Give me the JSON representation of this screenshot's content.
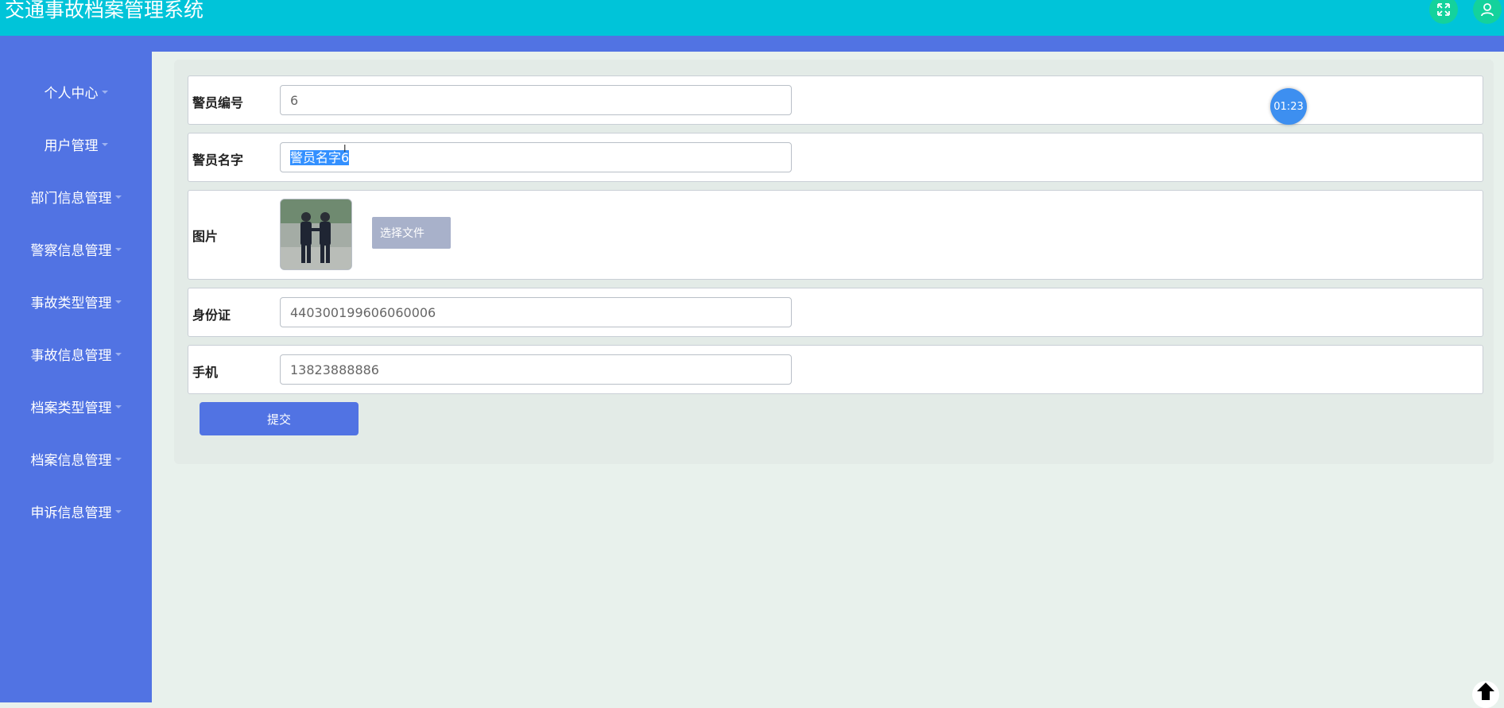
{
  "header": {
    "title": "交通事故档案管理系统",
    "fullscreen_icon": "expand-arrows-icon",
    "user_icon": "user-icon"
  },
  "sidebar": {
    "items": [
      {
        "label": "个人中心"
      },
      {
        "label": "用户管理"
      },
      {
        "label": "部门信息管理"
      },
      {
        "label": "警察信息管理"
      },
      {
        "label": "事故类型管理"
      },
      {
        "label": "事故信息管理"
      },
      {
        "label": "档案类型管理"
      },
      {
        "label": "档案信息管理"
      },
      {
        "label": "申诉信息管理"
      }
    ]
  },
  "form": {
    "fields": [
      {
        "label": "警员编号",
        "value": "6"
      },
      {
        "label": "警员名字",
        "value": "警员名字6"
      },
      {
        "label": "图片",
        "file_button": "选择文件"
      },
      {
        "label": "身份证",
        "value": "440300199606060006"
      },
      {
        "label": "手机",
        "value": "13823888886"
      }
    ],
    "submit_label": "提交"
  },
  "timer": {
    "text": "01:23"
  },
  "colors": {
    "topbar": "#00c4d9",
    "sidebar": "#5173e3",
    "primary_button": "#5173e3",
    "file_button": "#a8b1ca"
  }
}
